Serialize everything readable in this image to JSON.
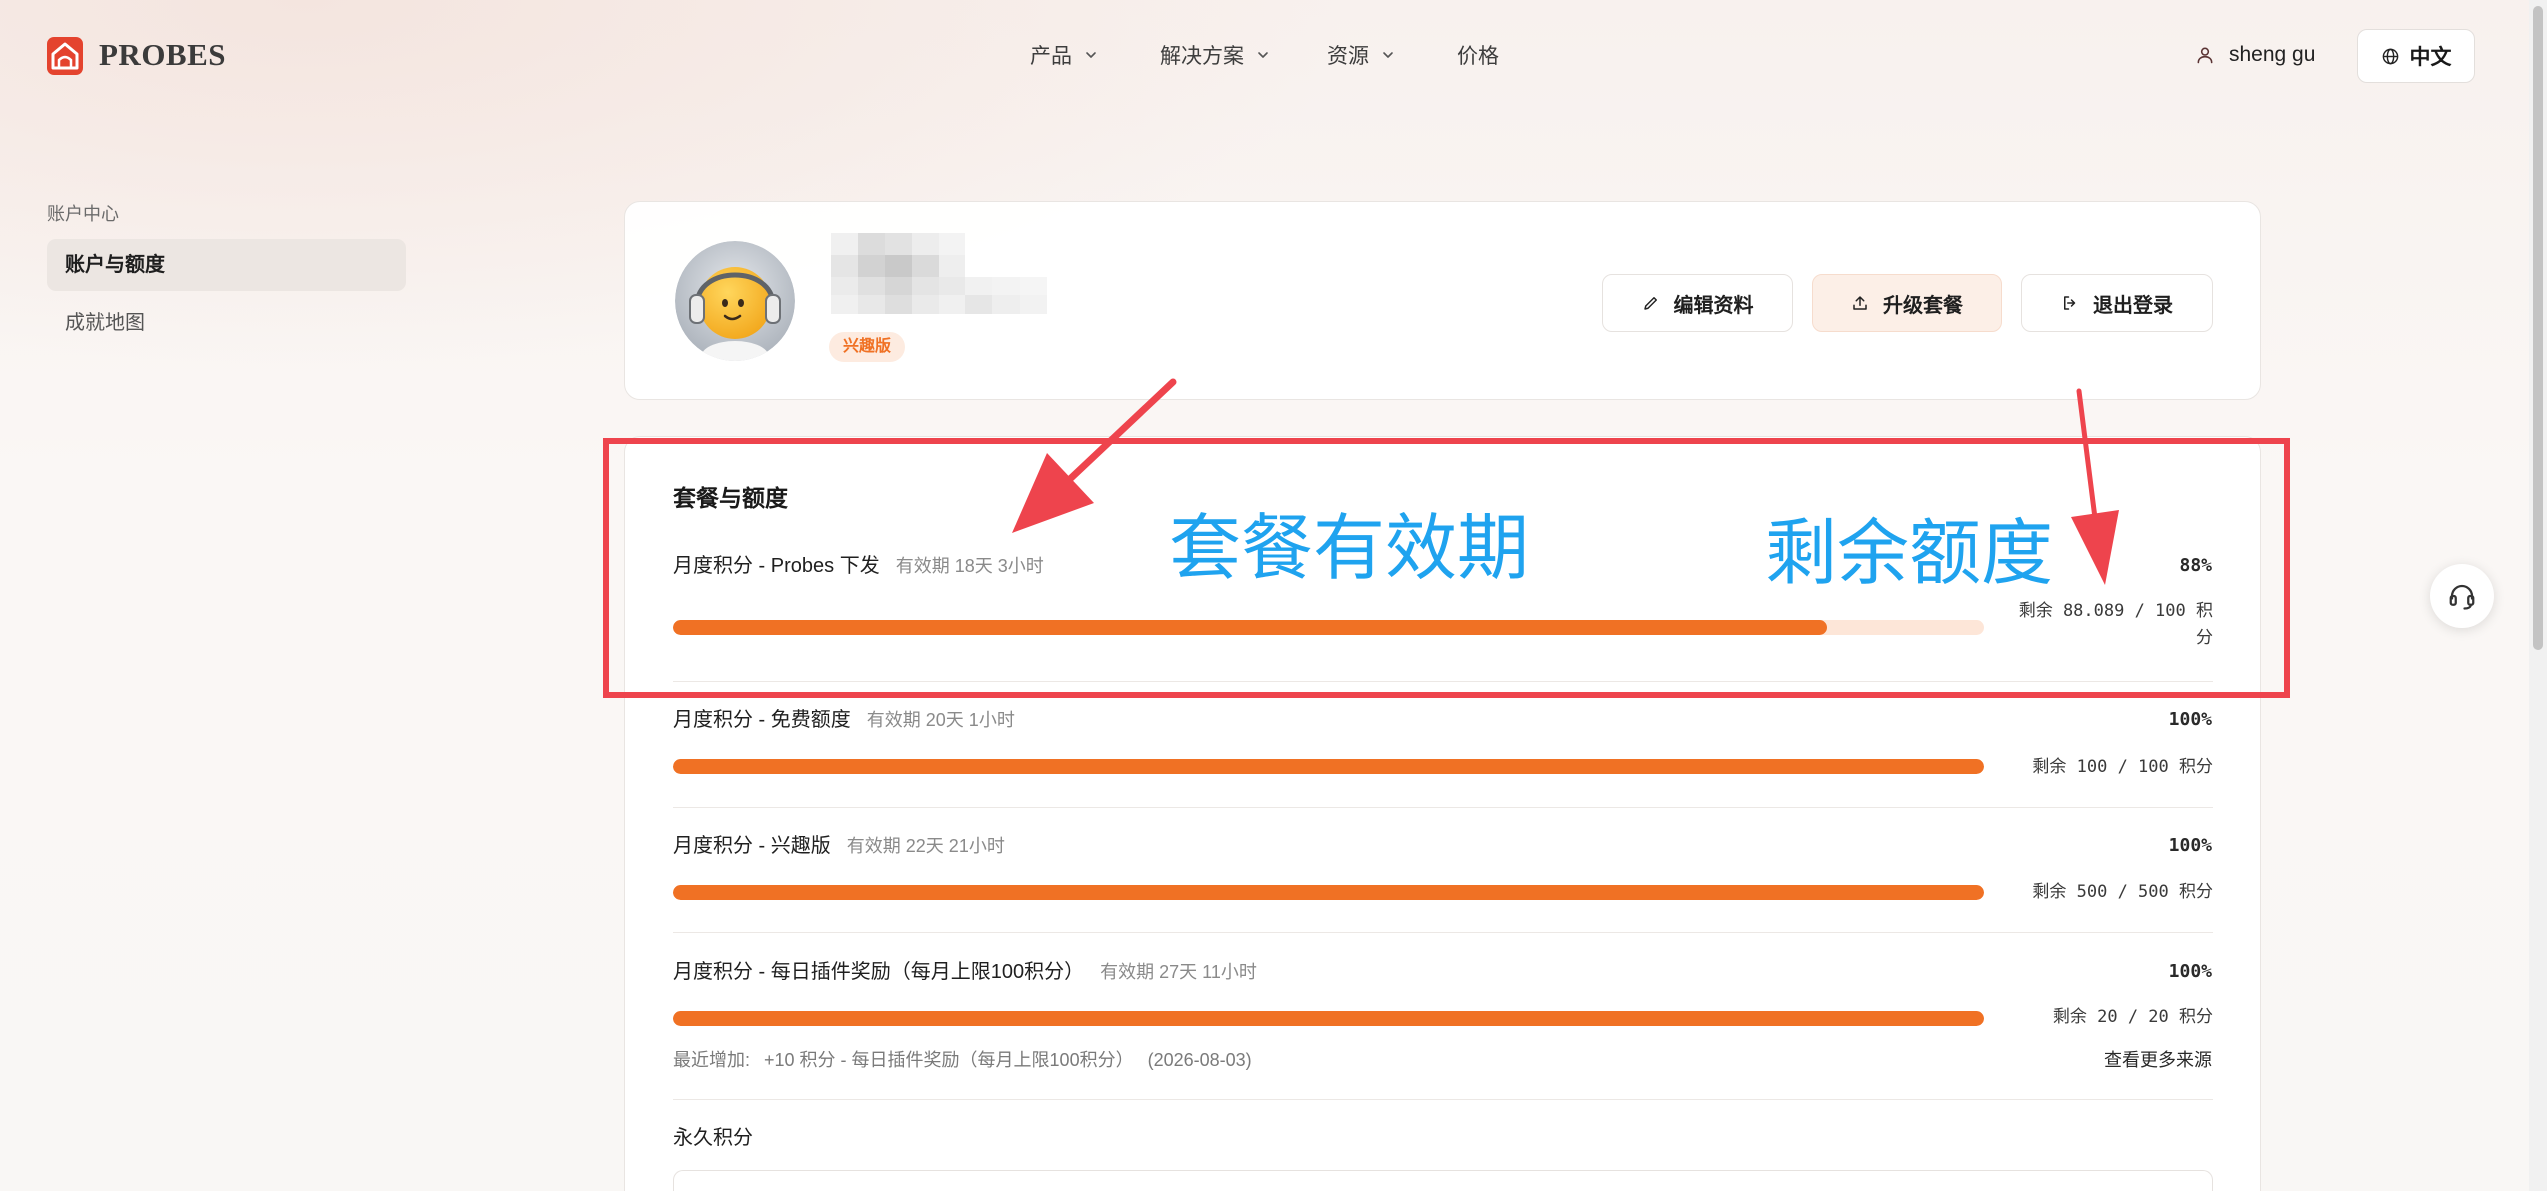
{
  "header": {
    "brand": "PROBES",
    "logo_icon": "probes-logo-icon",
    "nav": [
      {
        "label": "产品",
        "dropdown": true
      },
      {
        "label": "解决方案",
        "dropdown": true
      },
      {
        "label": "资源",
        "dropdown": true
      },
      {
        "label": "价格",
        "dropdown": false
      }
    ],
    "user_icon": "user-icon",
    "user_name": "sheng gu",
    "language_icon": "globe-icon",
    "language": "中文"
  },
  "sidebar": {
    "section_title": "账户中心",
    "items": [
      {
        "label": "账户与额度",
        "active": true
      },
      {
        "label": "成就地图",
        "active": false
      }
    ]
  },
  "profile": {
    "avatar": "smiley-headphones-avatar",
    "plan_badge": "兴趣版",
    "buttons": {
      "edit": {
        "label": "编辑资料",
        "icon": "pencil-icon"
      },
      "upgrade": {
        "label": "升级套餐",
        "icon": "upload-icon"
      },
      "logout": {
        "label": "退出登录",
        "icon": "logout-icon"
      }
    }
  },
  "quota": {
    "title": "套餐与额度",
    "items": [
      {
        "name": "月度积分 - Probes 下发",
        "validity": "有效期 18天 3小时",
        "percent": "88%",
        "fraction": 0.88,
        "remaining": "剩余 88.089 / 100 积分"
      },
      {
        "name": "月度积分 - 免费额度",
        "validity": "有效期 20天 1小时",
        "percent": "100%",
        "fraction": 1.0,
        "remaining": "剩余 100 / 100 积分"
      },
      {
        "name": "月度积分 - 兴趣版",
        "validity": "有效期 22天 21小时",
        "percent": "100%",
        "fraction": 1.0,
        "remaining": "剩余 500 / 500 积分"
      },
      {
        "name": "月度积分 - 每日插件奖励（每月上限100积分）",
        "validity": "有效期 27天 11小时",
        "percent": "100%",
        "fraction": 1.0,
        "remaining": "剩余 20 / 20 积分"
      }
    ],
    "recent_label": "最近增加:",
    "recent_entry": "+10 积分 - 每日插件奖励（每月上限100积分）",
    "recent_date": "(2026-08-03)",
    "more_sources": "查看更多来源",
    "permanent_title": "永久积分"
  },
  "annotations": {
    "validity_label": "套餐有效期",
    "remaining_label": "剩余额度"
  },
  "support_icon": "headset-icon",
  "colors": {
    "accent": "#f07124",
    "track": "#fde6d8",
    "active_bg": "#ece6e2",
    "badge_bg": "#fdebe0",
    "annotation_mark": "#ee444d",
    "annotation_text": "#1fa3ef"
  }
}
